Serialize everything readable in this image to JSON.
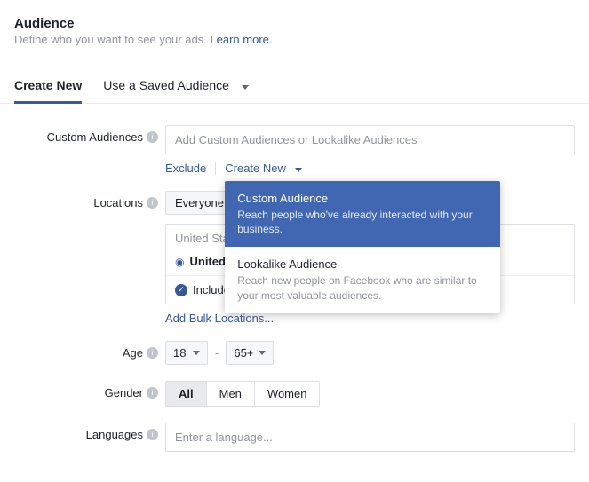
{
  "header": {
    "title": "Audience",
    "subtitle_prefix": "Define who you want to see your ads. ",
    "learn_more": "Learn more."
  },
  "tabs": {
    "create_new": "Create New",
    "saved": "Use a Saved Audience"
  },
  "labels": {
    "custom_audiences": "Custom Audiences",
    "locations": "Locations",
    "age": "Age",
    "gender": "Gender",
    "languages": "Languages"
  },
  "custom_audiences": {
    "placeholder": "Add Custom Audiences or Lookalike Audiences",
    "exclude": "Exclude",
    "create_new": "Create New",
    "dropdown": {
      "items": [
        {
          "title": "Custom Audience",
          "desc": "Reach people who've already interacted with your business."
        },
        {
          "title": "Lookalike Audience",
          "desc": "Reach new people on Facebook who are similar to your most valuable audiences."
        }
      ]
    }
  },
  "locations": {
    "scope_selected": "Everyone",
    "group_heading": "United States",
    "chip_label": "United States",
    "include_label": "Include",
    "add_bulk": "Add Bulk Locations..."
  },
  "age": {
    "min": "18",
    "max": "65+"
  },
  "gender": {
    "options": [
      "All",
      "Men",
      "Women"
    ],
    "selected_index": 0
  },
  "languages": {
    "placeholder": "Enter a language..."
  }
}
